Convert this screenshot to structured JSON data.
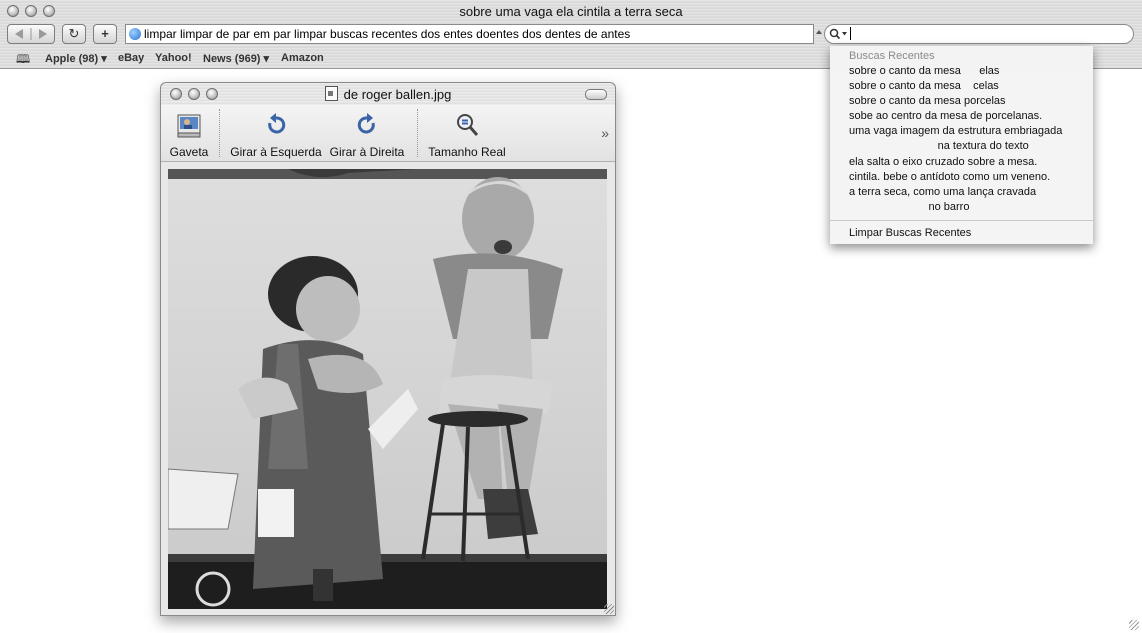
{
  "window": {
    "title": "sobre uma vaga ela cintila a terra seca"
  },
  "toolbar": {
    "back_icon": "back-arrow-icon",
    "forward_icon": "forward-arrow-icon",
    "reload_glyph": "↻",
    "add_glyph": "+",
    "url": "limpar limpar de par em par limpar buscas recentes dos entes doentes dos dentes de antes",
    "search_value": ""
  },
  "bookmarks": {
    "book_glyph": "🕮",
    "items": [
      {
        "label": "Apple (98) ▾"
      },
      {
        "label": "eBay"
      },
      {
        "label": "Yahoo!"
      },
      {
        "label": "News (969) ▾"
      },
      {
        "label": "Amazon"
      }
    ]
  },
  "search_dropdown": {
    "header": "Buscas Recentes",
    "items": [
      "sobre o canto da mesa      elas",
      "sobre o canto da mesa    celas",
      "sobre o canto da mesa porcelas",
      "sobe ao centro da mesa de porcelanas.",
      "uma vaga imagem da estrutura embriagada",
      "                             na textura do texto",
      "ela salta o eixo cruzado sobre a mesa.",
      "cintila. bebe o antídoto como um veneno.",
      "a terra seca, como uma lança cravada",
      "                          no barro"
    ],
    "clear_label": "Limpar Buscas Recentes"
  },
  "image_window": {
    "title": "de roger ballen.jpg",
    "tools": [
      {
        "label": "Gaveta"
      },
      {
        "label": "Girar à Esquerda"
      },
      {
        "label": "Girar à Direita"
      },
      {
        "label": "Tamanho Real"
      }
    ],
    "more_glyph": "»"
  },
  "colors": {
    "accent": "#3a63a8",
    "chrome": "#dcdcdc"
  }
}
